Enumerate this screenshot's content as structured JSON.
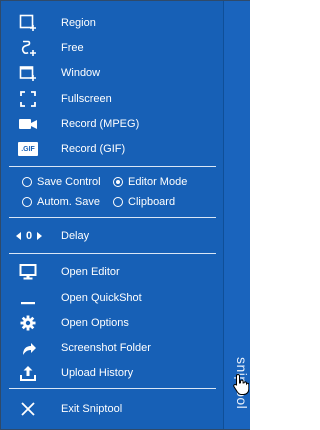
{
  "app": {
    "tab_label": "sniptool"
  },
  "capture_items": [
    {
      "label": "Region"
    },
    {
      "label": "Free"
    },
    {
      "label": "Window"
    },
    {
      "label": "Fullscreen"
    },
    {
      "label": "Record (MPEG)"
    },
    {
      "label": "Record (GIF)",
      "icon_text": ".GIF"
    }
  ],
  "options": {
    "save_control": "Save Control",
    "editor_mode": "Editor Mode",
    "autom_save": "Autom. Save",
    "clipboard": "Clipboard",
    "selected": "editor_mode"
  },
  "delay": {
    "value": "0",
    "label": "Delay"
  },
  "tool_items": [
    {
      "label": "Open Editor"
    },
    {
      "label": "Open QuickShot"
    },
    {
      "label": "Open Options"
    },
    {
      "label": "Screenshot Folder"
    },
    {
      "label": "Upload History"
    }
  ],
  "exit": {
    "label": "Exit Sniptool"
  },
  "colors": {
    "panel": "#1760b6",
    "text": "#ffffff",
    "separator": "#d9e6f6"
  }
}
